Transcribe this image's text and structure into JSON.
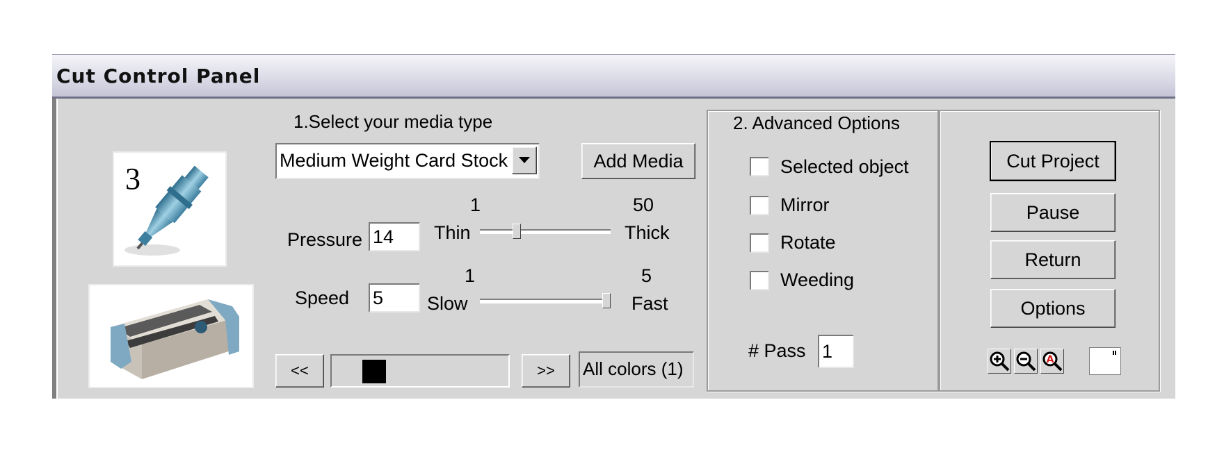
{
  "window": {
    "title": "Cut Control Panel"
  },
  "blade_image": {
    "number": "3",
    "icon": "blade-housing-icon"
  },
  "machine_image": {
    "icon": "cutting-machine-icon"
  },
  "media": {
    "heading": "1.Select your media type",
    "selected": "Medium Weight Card Stock",
    "add_button": "Add Media"
  },
  "pressure": {
    "label": "Pressure",
    "value": "14",
    "min_label": "1",
    "max_label": "50",
    "low_label": "Thin",
    "high_label": "Thick",
    "min": 1,
    "max": 50,
    "current": 14
  },
  "speed": {
    "label": "Speed",
    "value": "5",
    "min_label": "1",
    "max_label": "5",
    "low_label": "Slow",
    "high_label": "Fast",
    "min": 1,
    "max": 5,
    "current": 5
  },
  "colors": {
    "prev": "<<",
    "next": ">>",
    "swatch_color": "#000000",
    "current": "All colors (1)"
  },
  "advanced": {
    "heading": "2. Advanced Options",
    "options": [
      {
        "label": "Selected object",
        "checked": false
      },
      {
        "label": "Mirror",
        "checked": false
      },
      {
        "label": "Rotate",
        "checked": false
      },
      {
        "label": "Weeding",
        "checked": false
      }
    ],
    "pass_label": "# Pass",
    "pass_value": "1"
  },
  "actions": {
    "cut": "Cut Project",
    "pause": "Pause",
    "return": "Return",
    "options": "Options"
  },
  "zoom_tools": {
    "zoom_in": "zoom-in-icon",
    "zoom_out": "zoom-out-icon",
    "zoom_fit": "zoom-fit-icon",
    "page": "page-icon",
    "fit_letter": "A"
  },
  "colors_theme": {
    "panel": "#d6d6d6",
    "title_bar": "#c4c4d6",
    "accent_blue": "#5b8fb0"
  }
}
